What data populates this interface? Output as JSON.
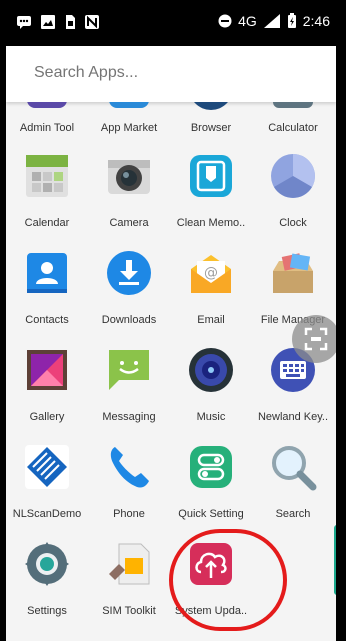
{
  "status_bar": {
    "network": "4G",
    "signal_label": "4G",
    "time": "2:46",
    "left_icons": [
      "chat-icon",
      "image-icon",
      "sim-card-icon",
      "nfc-icon"
    ]
  },
  "search": {
    "placeholder": "Search Apps..."
  },
  "apps": [
    {
      "label": "Admin Tool",
      "icon": "admin-tool-icon"
    },
    {
      "label": "App Market",
      "icon": "app-market-icon"
    },
    {
      "label": "Browser",
      "icon": "browser-icon"
    },
    {
      "label": "Calculator",
      "icon": "calculator-icon"
    },
    {
      "label": "Calendar",
      "icon": "calendar-icon"
    },
    {
      "label": "Camera",
      "icon": "camera-icon"
    },
    {
      "label": "Clean Memo..",
      "icon": "clean-memory-icon"
    },
    {
      "label": "Clock",
      "icon": "clock-icon"
    },
    {
      "label": "Contacts",
      "icon": "contacts-icon"
    },
    {
      "label": "Downloads",
      "icon": "downloads-icon"
    },
    {
      "label": "Email",
      "icon": "email-icon"
    },
    {
      "label": "File Manager",
      "icon": "file-manager-icon"
    },
    {
      "label": "Gallery",
      "icon": "gallery-icon"
    },
    {
      "label": "Messaging",
      "icon": "messaging-icon"
    },
    {
      "label": "Music",
      "icon": "music-icon"
    },
    {
      "label": "Newland Key..",
      "icon": "keyboard-icon"
    },
    {
      "label": "NLScanDemo",
      "icon": "nlscan-demo-icon"
    },
    {
      "label": "Phone",
      "icon": "phone-icon"
    },
    {
      "label": "Quick Setting",
      "icon": "quick-setting-icon"
    },
    {
      "label": "Search",
      "icon": "search-icon"
    },
    {
      "label": "Settings",
      "icon": "settings-icon"
    },
    {
      "label": "SIM Toolkit",
      "icon": "sim-toolkit-icon"
    },
    {
      "label": "System Upda..",
      "icon": "system-update-icon"
    }
  ],
  "colors": {
    "highlight": "#e41b1b",
    "system_update": "#d62e5a",
    "downloads": "#1e88e5",
    "messaging": "#8bc34a"
  }
}
